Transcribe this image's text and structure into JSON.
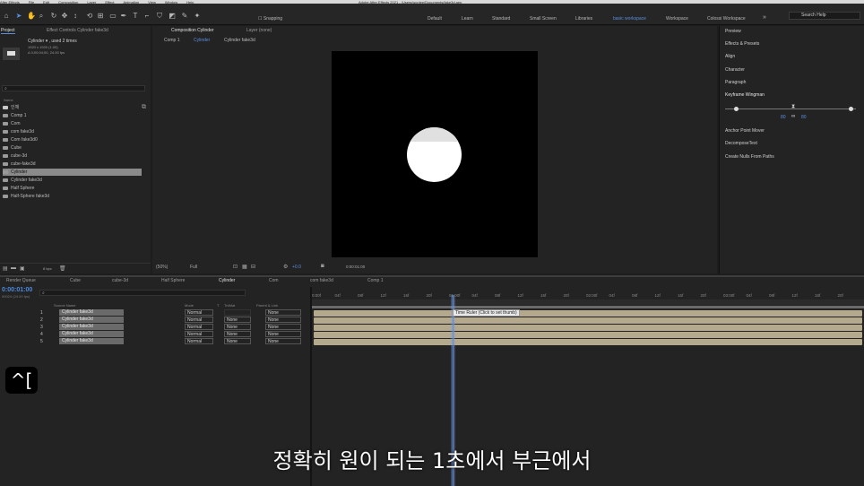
{
  "menubar": {
    "items": [
      "After Effects",
      "File",
      "Edit",
      "Composition",
      "Layer",
      "Effect",
      "Animation",
      "View",
      "Window",
      "Help"
    ],
    "title": "Adobe After Effects 2021 - /Users/wonlee/Documents/fake3d.aep"
  },
  "toolbar": {
    "snapping": "Snapping",
    "workspaces": [
      "Default",
      "Learn",
      "Standard",
      "Small Screen",
      "Libraries",
      "basic workspace",
      "Workspace",
      "Colossi Workspace"
    ],
    "active_workspace": "basic workspace",
    "search_placeholder": "Search Help"
  },
  "project": {
    "tab_project": "Project",
    "tab_effects": "Effect Controls Cylinder fake3d",
    "selected_name": "Cylinder ▾ , used 2 times",
    "selected_dims": "1920 x 1920 (1.00)",
    "selected_dur": "Δ 0;00;04;00, 24.00 fps",
    "col_name": "Name",
    "items": [
      "인체",
      "Comp 1",
      "Com",
      "com fake3d",
      "Com fake3d0",
      "Cube",
      "cube-3d",
      "cube-fake3d",
      "Cylinder",
      "Cylinder fake3d",
      "Half Sphere",
      "Half-Sphere fake3d"
    ],
    "selected_index": 8,
    "bpc": "8 bpc"
  },
  "viewer": {
    "tab_comp": "Composition Cylinder",
    "tab_layer": "Layer (none)",
    "crumbs": [
      "Comp 1",
      "Cylinder",
      "Cylinder fake3d"
    ],
    "zoom": "(50%)",
    "resolution": "Full",
    "exposure": "+0.0",
    "timecode": "0:00:01:00"
  },
  "right_panel": {
    "items": [
      "Preview",
      "Effects & Presets",
      "Align",
      "Character",
      "Paragraph",
      "Keyframe Wingman"
    ],
    "kw_left": "80",
    "kw_right": "80",
    "extras": [
      "Anchor Point Mover",
      "DecomposeText",
      "Create Nulls From Paths"
    ]
  },
  "timeline": {
    "tabs": [
      "Render Queue",
      "Cube",
      "cube-3d",
      "Half Sphere",
      "Cylinder",
      "Com",
      "com fake3d",
      "Comp 1"
    ],
    "active_tab": "Cylinder",
    "timecode": "0:00:01:00",
    "timecode_sub": "00024 (24.00 fps)",
    "headers": {
      "source": "Source Name",
      "mode": "Mode",
      "t": "T",
      "trkmat": "TrkMat",
      "parent": "Parent & Link"
    },
    "layers": [
      {
        "num": "1",
        "name": "Cylinder fake3d",
        "mode": "Normal",
        "trk": "",
        "parent": "None"
      },
      {
        "num": "2",
        "name": "Cylinder fake3d",
        "mode": "Normal",
        "trk": "None",
        "parent": "None"
      },
      {
        "num": "3",
        "name": "Cylinder fake3d",
        "mode": "Normal",
        "trk": "None",
        "parent": "None"
      },
      {
        "num": "4",
        "name": "Cylinder fake3d",
        "mode": "Normal",
        "trk": "None",
        "parent": "None"
      },
      {
        "num": "5",
        "name": "Cylinder fake3d",
        "mode": "Normal",
        "trk": "None",
        "parent": "None"
      }
    ],
    "ruler_ticks": [
      "0:00f",
      "04f",
      "08f",
      "12f",
      "16f",
      "20f",
      "01:00f",
      "04f",
      "08f",
      "12f",
      "16f",
      "20f",
      "02:00f",
      "04f",
      "08f",
      "12f",
      "16f",
      "20f",
      "03:00f",
      "04f",
      "08f",
      "12f",
      "16f",
      "20f"
    ],
    "tooltip": "Time Ruler (Click to set thumb)"
  },
  "overlay": {
    "keycap": "^[",
    "subtitle": "정확히 원이 되는 1초에서 부근에서"
  }
}
